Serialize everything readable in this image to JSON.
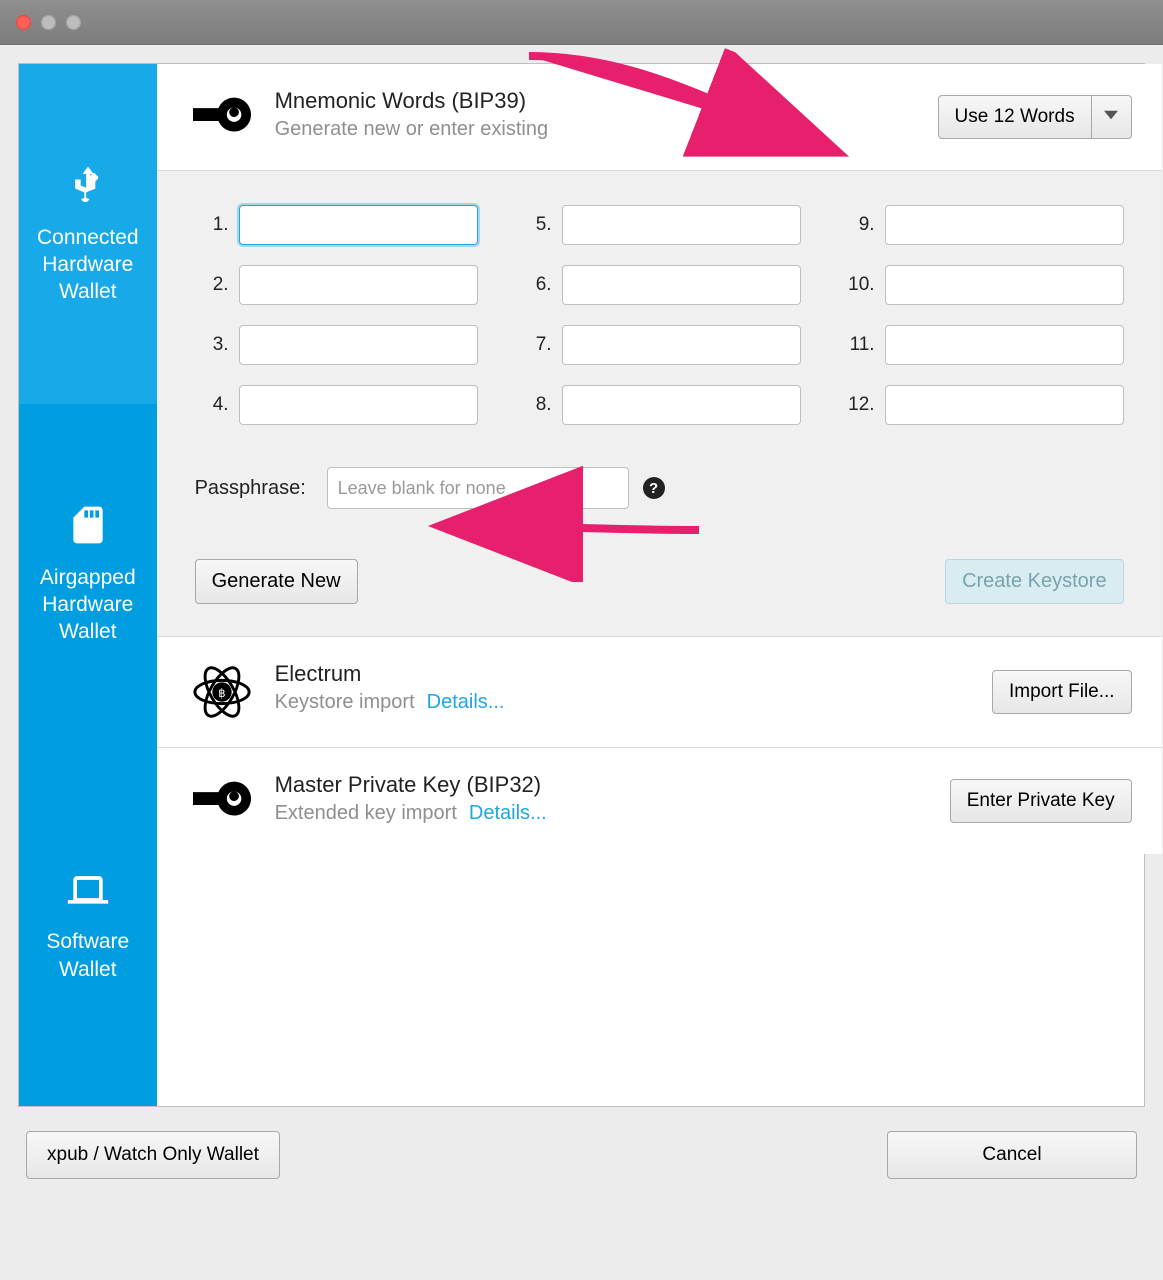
{
  "sidebar": {
    "items": [
      {
        "label": "Connected Hardware Wallet"
      },
      {
        "label": "Airgapped Hardware Wallet"
      },
      {
        "label": "Software Wallet"
      }
    ]
  },
  "mnemonic": {
    "title": "Mnemonic Words (BIP39)",
    "subtitle": "Generate new or enter existing",
    "use_words_button": "Use 12 Words",
    "word_count": 12,
    "passphrase_label": "Passphrase:",
    "passphrase_placeholder": "Leave blank for none",
    "generate_button": "Generate New",
    "create_keystore_button": "Create Keystore"
  },
  "electrum": {
    "title": "Electrum",
    "subtitle": "Keystore import",
    "details_link": "Details...",
    "import_button": "Import File..."
  },
  "master_key": {
    "title": "Master Private Key (BIP32)",
    "subtitle": "Extended key import",
    "details_link": "Details...",
    "enter_button": "Enter Private Key"
  },
  "footer": {
    "xpub_button": "xpub / Watch Only Wallet",
    "cancel_button": "Cancel"
  }
}
